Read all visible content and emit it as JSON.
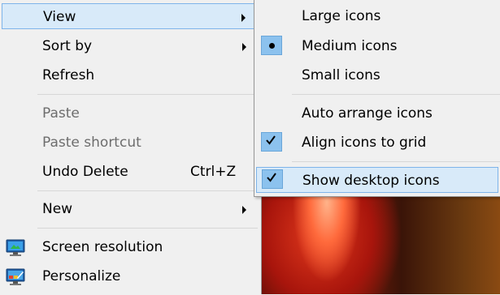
{
  "context_menu": {
    "items": [
      {
        "label": "View"
      },
      {
        "label": "Sort by"
      },
      {
        "label": "Refresh"
      },
      {
        "label": "Paste"
      },
      {
        "label": "Paste shortcut"
      },
      {
        "label": "Undo Delete",
        "shortcut": "Ctrl+Z"
      },
      {
        "label": "New"
      },
      {
        "label": "Screen resolution",
        "icon": "screen-resolution-icon"
      },
      {
        "label": "Personalize",
        "icon": "personalize-icon"
      }
    ]
  },
  "view_submenu": {
    "items": [
      {
        "label": "Large icons"
      },
      {
        "label": "Medium icons",
        "selected": true
      },
      {
        "label": "Small icons"
      },
      {
        "label": "Auto arrange icons"
      },
      {
        "label": "Align icons to grid",
        "checked": true
      },
      {
        "label": "Show desktop icons",
        "checked": true
      }
    ]
  },
  "colors": {
    "menu_background": "#f0f0f0",
    "highlight": "#d8eaf9",
    "highlight_border": "#7eb4ea",
    "check_background": "#8cc2ee",
    "disabled_text": "#6d6d6d"
  }
}
